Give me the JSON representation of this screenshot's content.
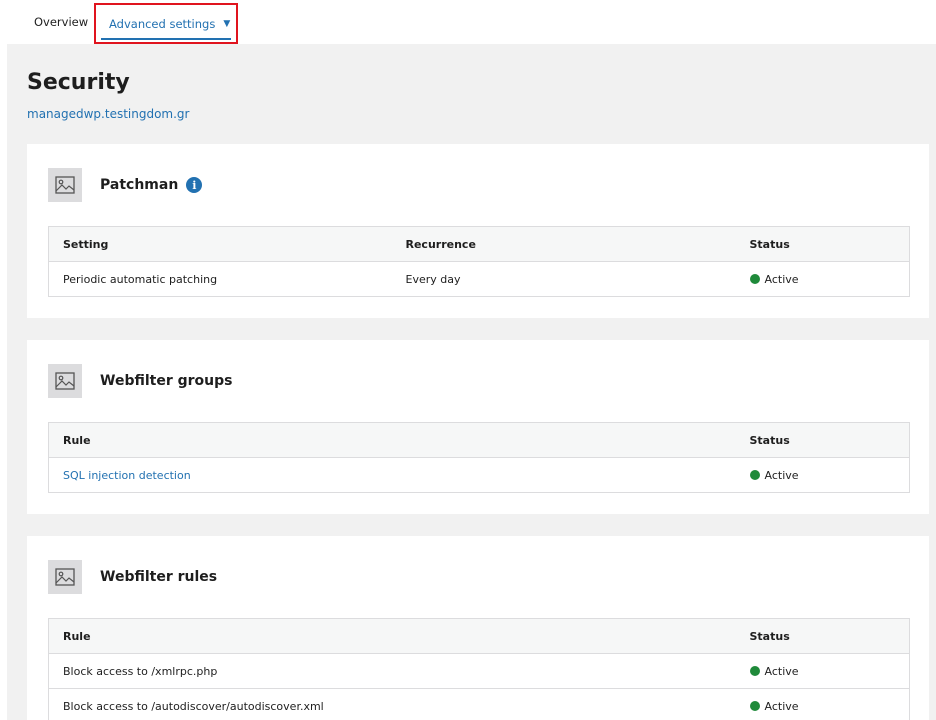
{
  "tabs": {
    "overview": "Overview",
    "advanced": "Advanced settings"
  },
  "page": {
    "title": "Security",
    "site": "managedwp.testingdom.gr"
  },
  "colors": {
    "accent": "#2271b1",
    "active_status": "#1f8a3a",
    "highlight_box": "#e0141e"
  },
  "patchman": {
    "title": "Patchman",
    "icon": "image-placeholder-icon",
    "columns": [
      "Setting",
      "Recurrence",
      "Status"
    ],
    "rows": [
      {
        "setting": "Periodic automatic patching",
        "recurrence": "Every day",
        "status": "Active"
      }
    ]
  },
  "webfilter_groups": {
    "title": "Webfilter groups",
    "icon": "image-placeholder-icon",
    "columns": [
      "Rule",
      "Status"
    ],
    "rows": [
      {
        "rule": "SQL injection detection",
        "status": "Active"
      }
    ]
  },
  "webfilter_rules": {
    "title": "Webfilter rules",
    "icon": "image-placeholder-icon",
    "columns": [
      "Rule",
      "Status"
    ],
    "rows": [
      {
        "rule": "Block access to /xmlrpc.php",
        "status": "Active"
      },
      {
        "rule": "Block access to /autodiscover/autodiscover.xml",
        "status": "Active"
      }
    ]
  }
}
